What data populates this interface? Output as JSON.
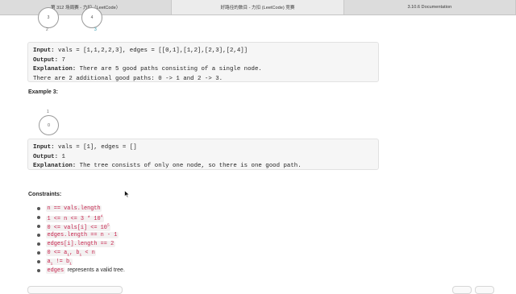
{
  "tabs": [
    {
      "label": "第 312 场周赛 - 力扣（LeetCode）"
    },
    {
      "label": "好路径的数目 - 力扣 (LeetCode) 竞赛"
    },
    {
      "label": "3.10.6 Documentation"
    }
  ],
  "example2": {
    "tree_nodes": [
      "3",
      "4"
    ],
    "tree_node_captions": [
      "2",
      "3"
    ],
    "input_label": "Input:",
    "input_value": " vals = [1,1,2,2,3], edges = [[0,1],[1,2],[2,3],[2,4]]",
    "output_label": "Output:",
    "output_value": " 7",
    "explanation_label": "Explanation:",
    "explanation_value": " There are 5 good paths consisting of a single node.",
    "explanation_line2": "There are 2 additional good paths: 0 -> 1 and 2 -> 3."
  },
  "example3": {
    "heading": "Example 3:",
    "tree_node_value": "0",
    "tree_node_caption": "1",
    "input_label": "Input:",
    "input_value": " vals = [1], edges = []",
    "output_label": "Output:",
    "output_value": " 1",
    "explanation_label": "Explanation:",
    "explanation_value": " The tree consists of only one node, so there is one good path."
  },
  "constraints": {
    "heading": "Constraints:",
    "c1": "n == vals.length",
    "c2_base": "1 <= n <= 3 * 10",
    "c2_exp": "4",
    "c3_base": "0 <= vals[i] <= 10",
    "c3_exp": "5",
    "c4": "edges.length == n - 1",
    "c5": "edges[i].length == 2",
    "c6_a": "0 <= a",
    "c6_i1": "i",
    "c6_b": ", b",
    "c6_i2": "i",
    "c6_c": " < n",
    "c7_a": "a",
    "c7_i1": "i",
    "c7_b": " != b",
    "c7_i2": "i",
    "c8_code": "edges",
    "c8_text": "represents a valid tree."
  }
}
